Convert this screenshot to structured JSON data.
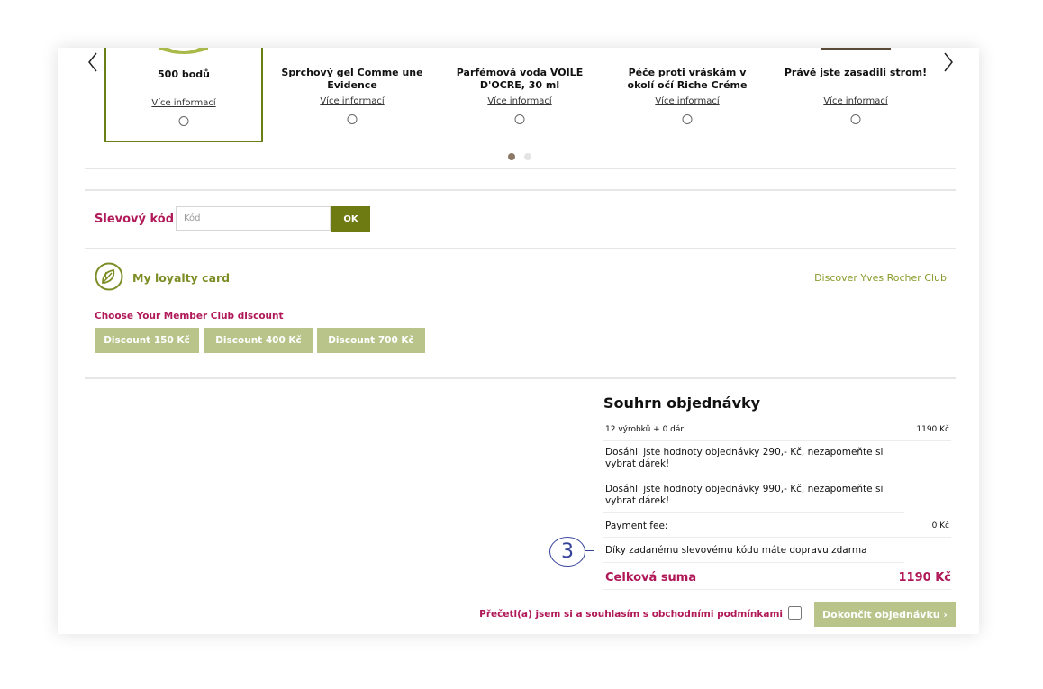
{
  "carousel": {
    "items": [
      {
        "name": "500 bodů",
        "link": "Více informací"
      },
      {
        "name": "Sprchový gel Comme une Evidence",
        "link": "Více informací"
      },
      {
        "name": "Parfémová voda VOILE D'OCRE, 30 ml",
        "link": "Více informací"
      },
      {
        "name": "Péče proti vráskám v okolí očí Riche Créme",
        "link": "Více informací"
      },
      {
        "name": "Právě jste zasadili strom!",
        "link": "Více informací"
      }
    ]
  },
  "discount_code": {
    "label": "Slevový kód",
    "placeholder": "Kód",
    "value": "",
    "ok_label": "OK"
  },
  "loyalty": {
    "title": "My loyalty card",
    "discover_link": "Discover Yves Rocher Club",
    "member_title": "Choose Your Member Club discount",
    "buttons": [
      "Discount 150 Kč",
      "Discount 400 Kč",
      "Discount 700 Kč"
    ]
  },
  "summary": {
    "title": "Souhrn objednávky",
    "items_text": "12 výrobků + 0 dár",
    "items_value": "1190 Kč",
    "gift_msg_1": "Dosáhli jste hodnoty objednávky 290,- Kč, nezapomeňte si vybrat dárek!",
    "gift_msg_2": "Dosáhli jste hodnoty objednávky 990,- Kč, nezapomeňte si vybrat dárek!",
    "payment_label": "Payment fee:",
    "payment_value": "0 Kč",
    "shipping_msg": "Díky zadanému slevovému kódu máte dopravu zdarma",
    "total_label": "Celková suma",
    "total_value": "1190 Kč"
  },
  "callout": {
    "number": "3"
  },
  "terms": {
    "label": "Přečetl(a) jsem si a souhlasím s obchodními podmínkami"
  },
  "finish": {
    "label": "Dokončit objednávku ›"
  },
  "colors": {
    "brand_magenta": "#b01858",
    "brand_olive": "#6e7b12",
    "light_olive": "#b8c48a",
    "callout_blue": "#37439a"
  }
}
